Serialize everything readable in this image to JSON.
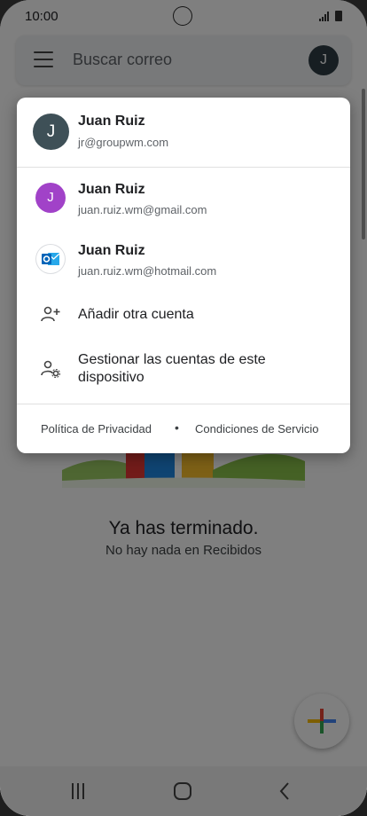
{
  "status_bar": {
    "time": "10:00"
  },
  "search_bar": {
    "placeholder": "Buscar correo",
    "avatar_initial": "J"
  },
  "empty_state": {
    "title": "Ya has terminado.",
    "subtitle": "No hay nada en Recibidos"
  },
  "accounts_menu": {
    "current_account": {
      "initial": "J",
      "name": "Juan Ruiz",
      "email": "jr@groupwm.com",
      "avatar_color": "#3e5057"
    },
    "other_accounts": [
      {
        "initial": "J",
        "name": "Juan Ruiz",
        "email": "juan.ruiz.wm@gmail.com",
        "avatar_color": "#a142c8",
        "icon": "gmail-avatar"
      },
      {
        "name": "Juan Ruiz",
        "email": "juan.ruiz.wm@hotmail.com",
        "icon": "outlook-icon"
      }
    ],
    "add_account_label": "Añadir otra cuenta",
    "manage_accounts_label": "Gestionar las cuentas de este dispositivo",
    "privacy_label": "Política de Privacidad",
    "separator": "•",
    "terms_label": "Condiciones de Servicio"
  },
  "colors": {
    "scrim": "#000000",
    "outlook_blue": "#0364b8"
  }
}
